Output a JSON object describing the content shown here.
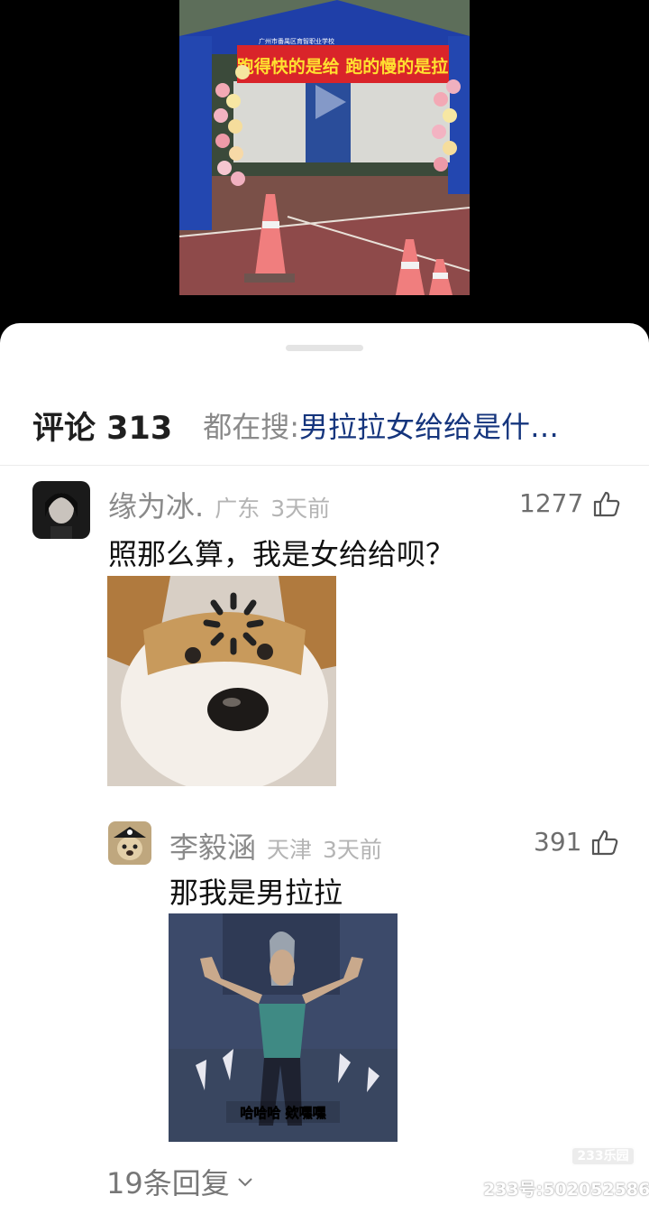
{
  "video": {
    "banner_top": "广州市番禺区育智职业学校",
    "banner_text": "跑得快的是给 跑的慢的是拉"
  },
  "header": {
    "comments_label": "评论 313",
    "search_prefix": "都在搜:",
    "search_query": "男拉拉女给给是什…"
  },
  "comments": [
    {
      "username": "缘为冰.",
      "region": "广东",
      "time": "3天前",
      "likes": "1277",
      "text": "照那么算，我是女给给呗？",
      "image": "loading-dog-meme"
    },
    {
      "username": "李毅涵",
      "region": "天津",
      "time": "3天前",
      "likes": "391",
      "text": "那我是男拉拉",
      "image": "dancing-character-meme",
      "image_caption": "哈哈哈 欸嘿嘿"
    }
  ],
  "replies_label": "19条回复",
  "watermark": {
    "logo": "233乐园",
    "id": "233号:502052586"
  },
  "icons": {
    "like": "thumbs-up-icon",
    "expand": "chevron-down-icon"
  },
  "colors": {
    "search_link": "#15357d",
    "meta_gray": "#b4b4b4"
  }
}
